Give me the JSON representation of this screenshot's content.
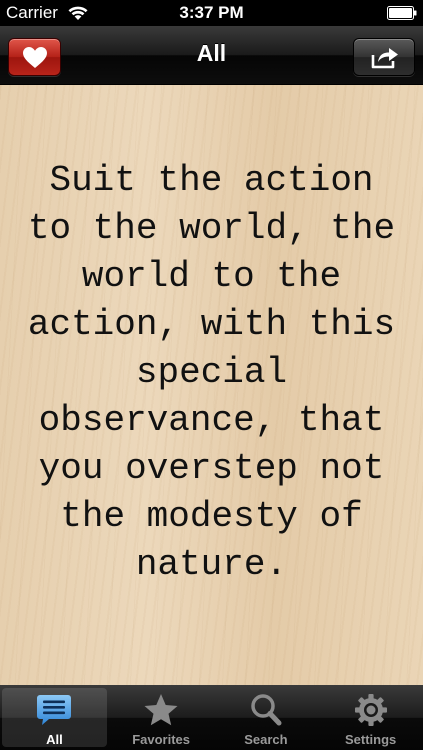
{
  "status_bar": {
    "carrier": "Carrier",
    "time": "3:37 PM",
    "icons": [
      "wifi-icon",
      "battery-icon"
    ]
  },
  "nav_bar": {
    "title": "All",
    "left_button_icon": "heart-icon",
    "right_button_icon": "share-icon",
    "left_button_color": "#b42118"
  },
  "quote": {
    "text": "Suit the action to the world, the world to the action, with this special observance, that you overstep not the modesty of nature."
  },
  "tab_bar": {
    "selected": "All",
    "tabs": [
      {
        "label": "All",
        "icon": "speech-bubble-icon",
        "selected": true,
        "color": "#5aa6ea"
      },
      {
        "label": "Favorites",
        "icon": "star-icon",
        "selected": false
      },
      {
        "label": "Search",
        "icon": "search-icon",
        "selected": false
      },
      {
        "label": "Settings",
        "icon": "gear-icon",
        "selected": false
      }
    ]
  }
}
